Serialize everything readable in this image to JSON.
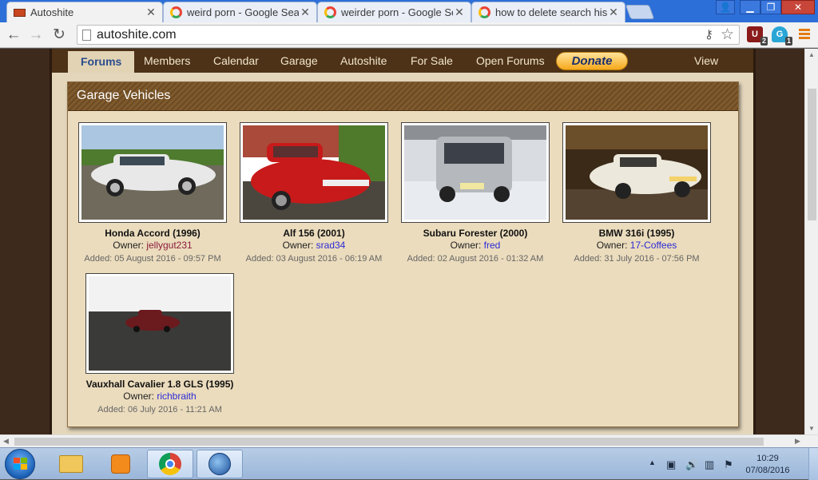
{
  "browser": {
    "tabs": [
      {
        "title": "Autoshite",
        "icon": "autoshite-favicon",
        "active": true
      },
      {
        "title": "weird porn - Google Searc",
        "icon": "google-favicon",
        "active": false
      },
      {
        "title": "weirder porn - Google Sea",
        "icon": "google-favicon",
        "active": false
      },
      {
        "title": "how to delete search histo",
        "icon": "google-favicon",
        "active": false
      }
    ],
    "url": "autoshite.com",
    "extensions": [
      {
        "name": "ublock-icon",
        "label": "U",
        "badge": "2"
      },
      {
        "name": "ghostery-icon",
        "label": "G",
        "badge": "1"
      }
    ]
  },
  "site": {
    "nav": {
      "items": [
        "Forums",
        "Members",
        "Calendar",
        "Garage",
        "Autoshite",
        "For Sale",
        "Open Forums"
      ],
      "donate": "Donate",
      "new_content": "View New Content"
    },
    "panel_title": "Garage Vehicles",
    "owner_label": "Owner:",
    "vehicles": [
      {
        "name": "Honda Accord (1996)",
        "owner": "jellygut231",
        "added": "Added: 05 August 2016 - 09:57 PM",
        "color": "#e8e8e8"
      },
      {
        "name": "Alf 156 (2001)",
        "owner": "srad34",
        "added": "Added: 03 August 2016 - 06:19 AM",
        "color": "#c81a1a"
      },
      {
        "name": "Subaru Forester (2000)",
        "owner": "fred",
        "added": "Added: 02 August 2016 - 01:32 AM",
        "color": "#b5b8bc"
      },
      {
        "name": "BMW 316i (1995)",
        "owner": "17-Coffees",
        "added": "Added: 31 July 2016 - 07:56 PM",
        "color": "#ece8dc"
      },
      {
        "name": "Vauxhall Cavalier 1.8 GLS (1995)",
        "owner": "richbraith",
        "added": "Added: 06 July 2016 - 11:21 AM",
        "color": "#6b1a1e"
      }
    ]
  },
  "taskbar": {
    "apps": [
      "explorer-icon",
      "media-player-icon",
      "chrome-icon",
      "thunderbird-icon"
    ],
    "time": "10:29",
    "date": "07/08/2016"
  },
  "colors": {
    "site_brown": "#4d3217",
    "panel_bg": "#ebdcbd",
    "link_blue": "#2a2ad6",
    "chrome_blue": "#2d6fd8"
  }
}
